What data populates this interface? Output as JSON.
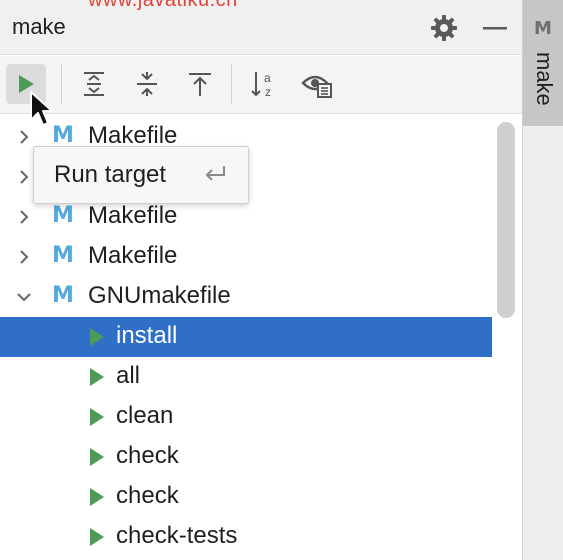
{
  "window": {
    "title": "make",
    "watermark": "www.javatiku.cn"
  },
  "toolbar": {
    "buttons": [
      {
        "icon": "run-target-icon"
      },
      {
        "icon": "expand-all-icon"
      },
      {
        "icon": "collapse-all-icon"
      },
      {
        "icon": "locate-icon"
      },
      {
        "icon": "sort-alphabetically-icon"
      },
      {
        "icon": "show-filter-icon"
      }
    ]
  },
  "tooltip": {
    "text": "Run target",
    "shortcut": "↩"
  },
  "tree": {
    "rows": [
      {
        "label": "Makefile",
        "expanded": false
      },
      {
        "label": "",
        "expanded": false
      },
      {
        "label": "Makefile",
        "expanded": false
      },
      {
        "label": "Makefile",
        "expanded": false
      },
      {
        "label": "GNUmakefile",
        "expanded": true
      },
      {
        "label": "install",
        "selected": true
      },
      {
        "label": "all"
      },
      {
        "label": "clean"
      },
      {
        "label": "check"
      },
      {
        "label": "check"
      },
      {
        "label": "check-tests"
      }
    ]
  },
  "side_panel": {
    "icon": "M",
    "label": "make"
  },
  "colors": {
    "selection": "#2f6fc8",
    "run_green": "#4e9a57",
    "makefile_icon": "#52a9e2",
    "watermark": "#e0433a"
  }
}
